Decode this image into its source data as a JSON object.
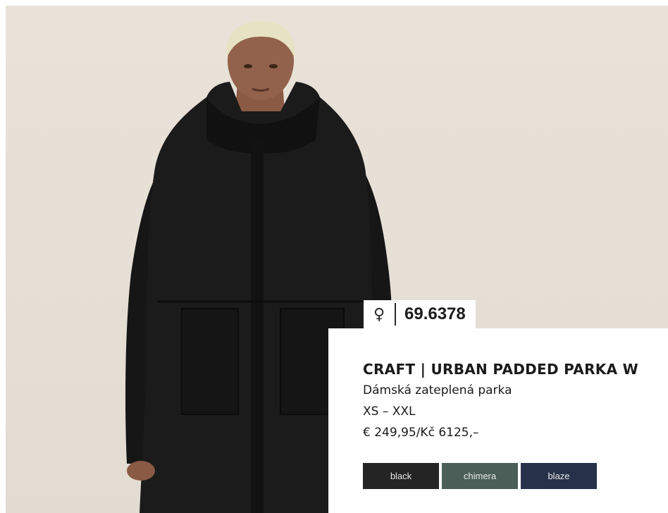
{
  "product": {
    "gender_symbol": "♀",
    "code": "69.6378",
    "title": "CRAFT | URBAN PADDED PARKA W",
    "subtitle": "Dámská zateplená parka",
    "sizes": "XS – XXL",
    "price": "€ 249,95/Kč 6125,–",
    "colors": [
      {
        "label": "black",
        "hex": "#242424"
      },
      {
        "label": "chimera",
        "hex": "#4b5f58"
      },
      {
        "label": "blaze",
        "hex": "#27324a"
      }
    ]
  }
}
